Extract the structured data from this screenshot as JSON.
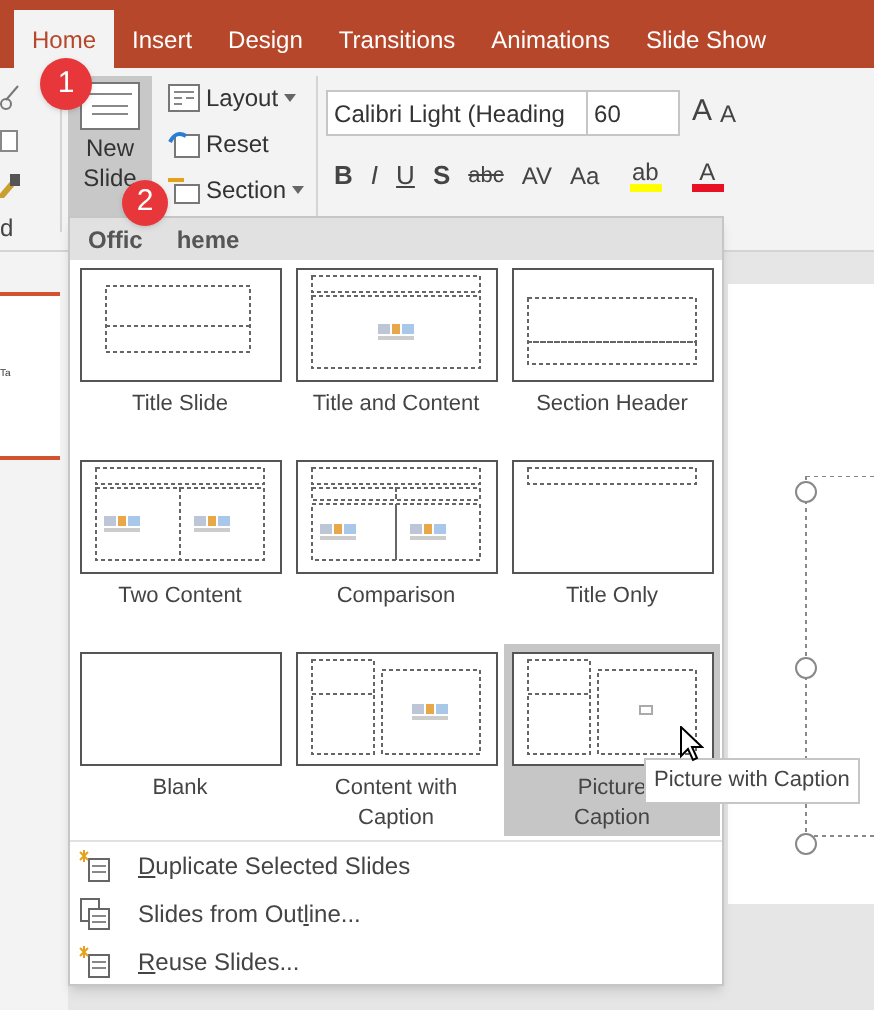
{
  "tabs": [
    {
      "label": "Home",
      "selected": true
    },
    {
      "label": "Insert",
      "selected": false
    },
    {
      "label": "Design",
      "selected": false
    },
    {
      "label": "Transitions",
      "selected": false
    },
    {
      "label": "Animations",
      "selected": false
    },
    {
      "label": "Slide Show",
      "selected": false
    }
  ],
  "ribbon": {
    "clipboard_group_label": "d",
    "new_slide": {
      "label_lines": [
        "New",
        "Slide"
      ],
      "pressed": true
    },
    "slide_buttons": [
      {
        "label": "Layout",
        "dropdown": true,
        "kind": "layout"
      },
      {
        "label": "Reset",
        "dropdown": false,
        "kind": "reset"
      },
      {
        "label": "Section",
        "dropdown": true,
        "kind": "section"
      }
    ],
    "font_name": "Calibri Light (Heading",
    "font_size": "60",
    "size_buttons": [
      {
        "label": "A",
        "kind": "grow"
      },
      {
        "label": "A",
        "kind": "shrink"
      }
    ],
    "format_buttons": [
      {
        "label": "B",
        "kind": "bold"
      },
      {
        "label": "I",
        "kind": "italic"
      },
      {
        "label": "U",
        "kind": "underline"
      },
      {
        "label": "S",
        "kind": "shadow"
      },
      {
        "label": "abc",
        "kind": "strike"
      },
      {
        "label": "AV",
        "kind": "spacing"
      },
      {
        "label": "Aa",
        "kind": "case"
      }
    ],
    "highlight": {
      "label": "ab",
      "color": "#ffff00"
    },
    "font_color": {
      "label": "A",
      "color": "#e81123"
    }
  },
  "callouts": [
    {
      "number": "1"
    },
    {
      "number": "2"
    }
  ],
  "slide_thumbnail": {
    "text": "Ta"
  },
  "gallery": {
    "header_parts": [
      "Offic",
      "heme"
    ],
    "layouts": [
      {
        "label_lines": [
          "Title Slide"
        ],
        "kind": "title",
        "selected": false
      },
      {
        "label_lines": [
          "Title and Content"
        ],
        "kind": "title_content",
        "selected": false
      },
      {
        "label_lines": [
          "Section Header"
        ],
        "kind": "section",
        "selected": false
      },
      {
        "label_lines": [
          "Two Content"
        ],
        "kind": "two_content",
        "selected": false
      },
      {
        "label_lines": [
          "Comparison"
        ],
        "kind": "comparison",
        "selected": false
      },
      {
        "label_lines": [
          "Title Only"
        ],
        "kind": "title_only",
        "selected": false
      },
      {
        "label_lines": [
          "Blank"
        ],
        "kind": "blank",
        "selected": false
      },
      {
        "label_lines": [
          "Content with",
          "Caption"
        ],
        "kind": "content_caption",
        "selected": false
      },
      {
        "label_lines": [
          "Picture",
          "Caption"
        ],
        "kind": "picture_caption",
        "selected": true
      }
    ]
  },
  "menu_items": [
    {
      "key": "D",
      "post": "uplicate Selected Slides",
      "kind": "duplicate"
    },
    {
      "pre": "Slides from Out",
      "key": "l",
      "post": "ine...",
      "kind": "outline"
    },
    {
      "key": "R",
      "post": "euse Slides...",
      "kind": "reuse"
    }
  ],
  "tooltip": "Picture with Caption"
}
